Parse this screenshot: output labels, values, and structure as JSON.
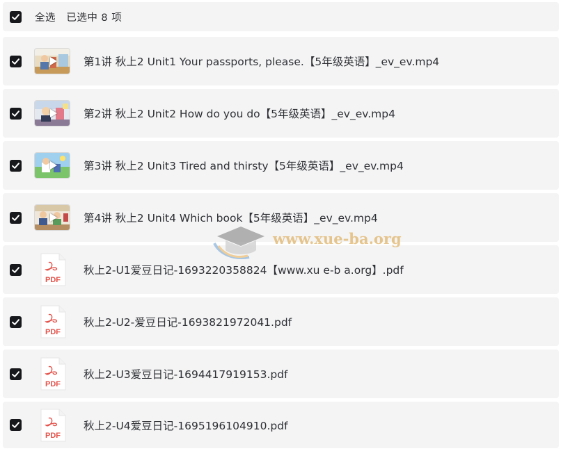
{
  "header": {
    "select_all_label": "全选",
    "selected_summary": "已选中 8 项",
    "checked": true
  },
  "files": [
    {
      "type": "video",
      "name": "第1讲 秋上2 Unit1 Your passports, please.【5年级英语】_ev_ev.mp4",
      "checked": true
    },
    {
      "type": "video",
      "name": "第2讲 秋上2 Unit2 How do you do【5年级英语】_ev_ev.mp4",
      "checked": true
    },
    {
      "type": "video",
      "name": "第3讲 秋上2 Unit3 Tired and thirsty【5年级英语】_ev_ev.mp4",
      "checked": true
    },
    {
      "type": "video",
      "name": "第4讲 秋上2 Unit4 Which book【5年级英语】_ev_ev.mp4",
      "checked": true
    },
    {
      "type": "pdf",
      "name": "秋上2-U1爱豆日记-1693220358824【www.xu e-b a.org】.pdf",
      "checked": true
    },
    {
      "type": "pdf",
      "name": "秋上2-U2-爱豆日记-1693821972041.pdf",
      "checked": true
    },
    {
      "type": "pdf",
      "name": "秋上2-U3爱豆日记-1694417919153.pdf",
      "checked": true
    },
    {
      "type": "pdf",
      "name": "秋上2-U4爱豆日记-1695196104910.pdf",
      "checked": true
    }
  ],
  "pdf_icon_label": "PDF",
  "watermark": "www.xue-ba.org",
  "colors": {
    "row_background": "#f4f4f5",
    "checkbox": "#17181b",
    "pdf_red": "#e3524a",
    "text": "#2e3034"
  }
}
